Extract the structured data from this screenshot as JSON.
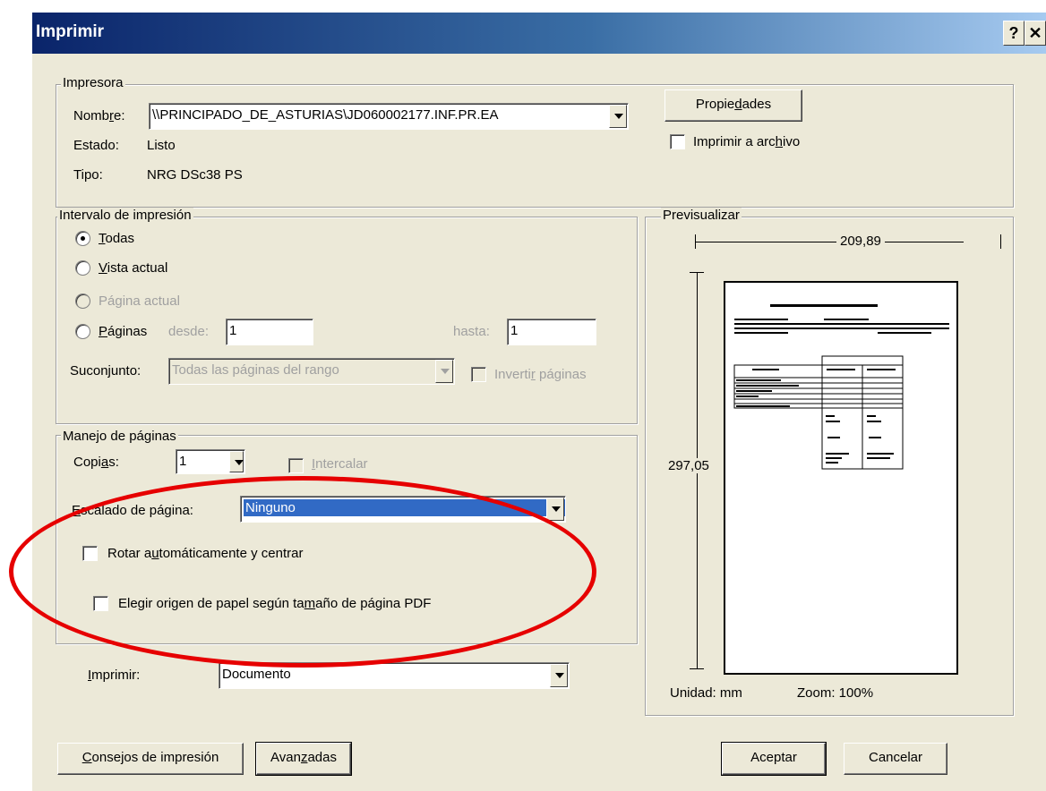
{
  "window": {
    "title": "Imprimir",
    "help_btn": "?",
    "close_btn": "✕"
  },
  "printer": {
    "legend": "Impresora",
    "name_label": "Nombre:",
    "name_value": "\\\\PRINCIPADO_DE_ASTURIAS\\JD060002177.INF.PR.EA",
    "state_label": "Estado:",
    "state_value": "Listo",
    "type_label": "Tipo:",
    "type_value": "NRG DSc38 PS",
    "properties_button": "Propiedades",
    "print_to_file": "Imprimir a archivo",
    "print_to_file_checked": false
  },
  "range": {
    "legend": "Intervalo de impresión",
    "all": "Todas",
    "current_view": "Vista actual",
    "current_page": "Página actual",
    "pages": "Páginas",
    "from_label": "desde:",
    "from_value": "1",
    "to_label": "hasta:",
    "to_value": "1",
    "subset_label": "Suconjunto:",
    "subset_value": "Todas las páginas del rango",
    "reverse_pages": "Invertir páginas",
    "selected": "Todas"
  },
  "handling": {
    "legend": "Manejo de páginas",
    "copies_label": "Copias:",
    "copies_value": "1",
    "collate": "Intercalar",
    "scaling_label": "Escalado de página:",
    "scaling_value": "Ninguno",
    "auto_rotate": "Rotar automáticamente y centrar",
    "auto_rotate_checked": false,
    "paper_source": "Elegir origen de papel según tamaño de página PDF",
    "paper_source_checked": false
  },
  "print_what": {
    "label": "Imprimir:",
    "value": "Documento"
  },
  "preview": {
    "legend": "Previsualizar",
    "width": "209,89",
    "height": "297,05",
    "unit": "Unidad: mm",
    "zoom": "Zoom: 100%"
  },
  "buttons": {
    "tips": "Consejos de impresión",
    "advanced": "Avanzadas",
    "ok": "Aceptar",
    "cancel": "Cancelar"
  },
  "colors": {
    "annotation_ellipse": "#e60000",
    "selection": "#316ac5",
    "titlebar": "#0a246a"
  }
}
